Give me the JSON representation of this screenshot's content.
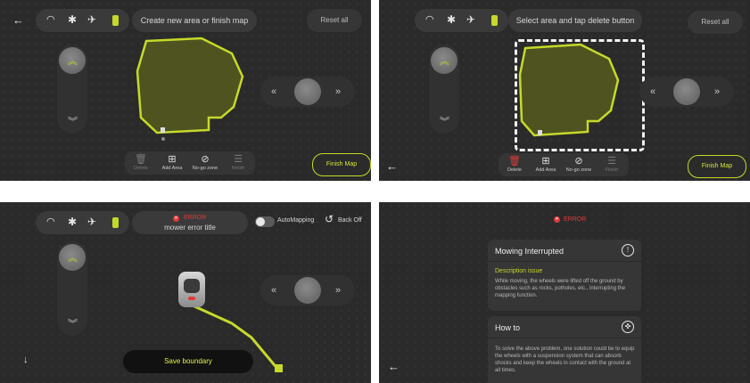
{
  "colors": {
    "accent": "#c6d92a",
    "error": "#e03a3a",
    "panel_bg": "#2a2a2a"
  },
  "icons": {
    "back": "arrow-left-icon",
    "wifi": "wifi-icon",
    "bluetooth": "bluetooth-icon",
    "satellite": "satellite-icon",
    "battery": "battery-icon",
    "up": "double-chevron-up-icon",
    "down": "double-chevron-down-icon",
    "left": "double-chevron-left-icon",
    "right": "double-chevron-right-icon",
    "reset": "reset-arrow-icon",
    "error": "error-circle-icon",
    "info": "info-circle-icon",
    "help": "lifebuoy-icon"
  },
  "screen1": {
    "status_message": "Create new area or finish map",
    "reset_label": "Reset all",
    "toolbar": [
      "Delete",
      "Add Area",
      "No-go zone",
      "Finish"
    ],
    "finish_label": "Finish Map"
  },
  "screen2": {
    "status_message": "Select area and tap delete button",
    "reset_label": "Reset all",
    "toolbar": [
      "Delete",
      "Add Area",
      "No-go zone",
      "Finish"
    ],
    "finish_label": "Finish Map"
  },
  "screen3": {
    "error_label": "ERROR",
    "error_title": "mower error title",
    "toggle_label": "AutoMapping",
    "back_off_label": "Back Off",
    "save_label": "Save boundary"
  },
  "screen4": {
    "error_label": "ERROR",
    "card1_title": "Mowing Interrupted",
    "card1_subtitle": "Description issue",
    "card1_body": "While moving, the wheels were lifted off the ground by obstacles such as rocks, potholes, etc., interrupting the mapping function.",
    "card2_title": "How to",
    "card2_body": "To solve the above problem, one solution could be to equip the wheels with a suspension system that can absorb shocks and keep the wheels in contact with the ground at all times."
  }
}
